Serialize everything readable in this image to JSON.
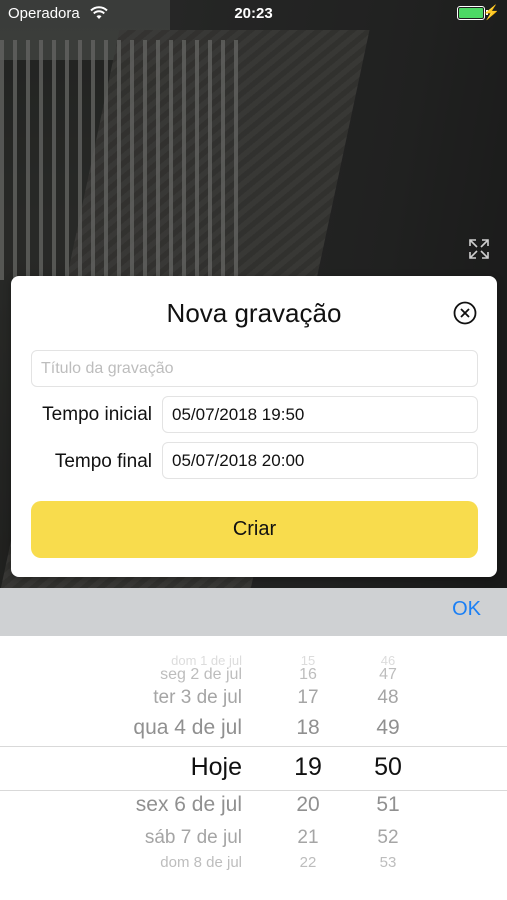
{
  "status_bar": {
    "carrier": "Operadora",
    "time": "20:23",
    "battery_color": "#4cd964"
  },
  "modal": {
    "title": "Nova gravação",
    "title_placeholder": "Título da gravação",
    "start_label": "Tempo inicial",
    "start_value": "05/07/2018 19:50",
    "end_label": "Tempo final",
    "end_value": "05/07/2018 20:00",
    "create_button": "Criar"
  },
  "picker": {
    "ok_label": "OK",
    "rows": [
      {
        "day": "dom 1 de jul",
        "hour": "15",
        "minute": "46"
      },
      {
        "day": "seg 2 de jul",
        "hour": "16",
        "minute": "47"
      },
      {
        "day": "ter 3 de jul",
        "hour": "17",
        "minute": "48"
      },
      {
        "day": "qua 4 de jul",
        "hour": "18",
        "minute": "49"
      },
      {
        "day": "Hoje",
        "hour": "19",
        "minute": "50"
      },
      {
        "day": "sex 6 de jul",
        "hour": "20",
        "minute": "51"
      },
      {
        "day": "sáb 7 de jul",
        "hour": "21",
        "minute": "52"
      },
      {
        "day": "dom 8 de jul",
        "hour": "22",
        "minute": "53"
      }
    ]
  },
  "colors": {
    "accent_button": "#f8dc4d",
    "ok_blue": "#1a7ff5"
  }
}
